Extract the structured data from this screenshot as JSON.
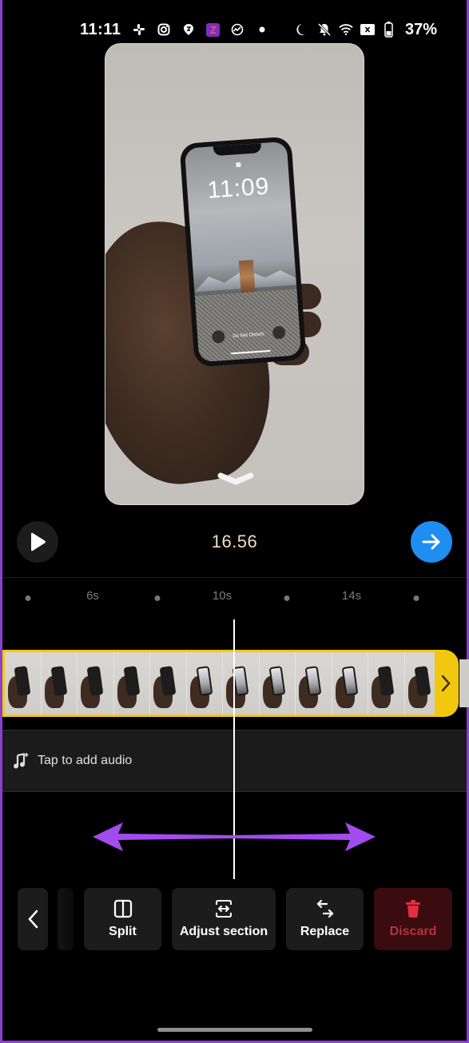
{
  "status_bar": {
    "time": "11:11",
    "left_icons": [
      "slack-icon",
      "instagram-icon",
      "swiggy-icon",
      "zomato-icon",
      "basecamp-icon",
      "dot-icon"
    ],
    "zomato_badge": "Z",
    "right_icons": [
      "moon-icon",
      "bell-muted-icon",
      "wifi-icon",
      "no-sim-icon",
      "battery-icon"
    ],
    "battery": "37%"
  },
  "preview": {
    "lock_screen_time": "11:09",
    "lock_screen_dnd": "Do Not Disturb",
    "collapse_icon": "chevron-down-icon"
  },
  "controls": {
    "play_icon": "play-icon",
    "current_time": "16.56",
    "next_icon": "arrow-right-icon",
    "accent_color": "#1e8ef0",
    "time_color": "#f2dcc0"
  },
  "ruler": {
    "ticks": [
      "6s",
      "10s",
      "14s"
    ]
  },
  "timeline": {
    "clip_color": "#f2c80f",
    "frame_count": 12,
    "frames_lit": [
      false,
      false,
      false,
      false,
      false,
      true,
      true,
      true,
      true,
      true,
      false,
      false
    ],
    "handle_icon": "chevron-right-icon"
  },
  "audio": {
    "label": "Tap to add audio",
    "icon": "music-add-icon"
  },
  "annotation": {
    "type": "double-headed-arrow",
    "color": "#a24bef"
  },
  "toolbar": {
    "back_icon": "chevron-left-icon",
    "buttons": [
      {
        "label": "Split",
        "icon": "split-icon"
      },
      {
        "label": "Adjust section",
        "icon": "adjust-section-icon"
      },
      {
        "label": "Replace",
        "icon": "replace-icon"
      },
      {
        "label": "Discard",
        "icon": "trash-icon",
        "color": "#e0313e"
      }
    ]
  }
}
